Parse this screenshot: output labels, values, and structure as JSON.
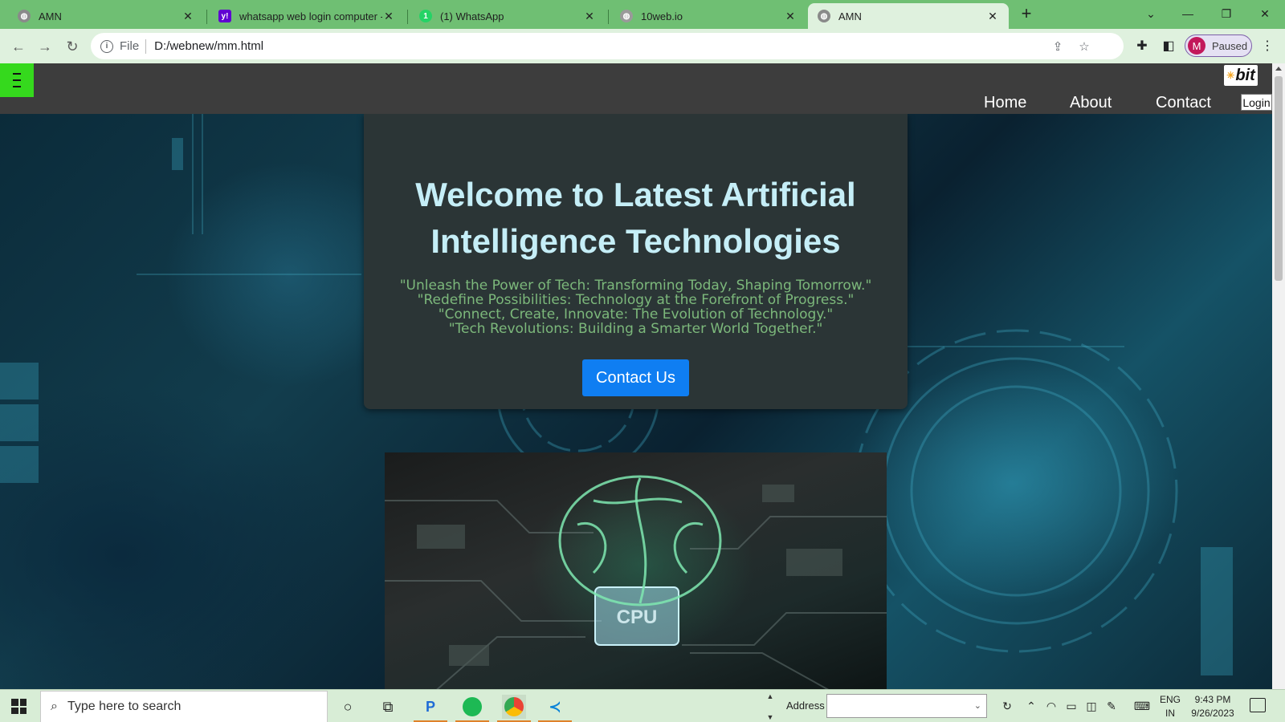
{
  "browser": {
    "tabs": [
      {
        "title": "AMN",
        "icon": "globe-icon",
        "active": false
      },
      {
        "title": "whatsapp web login computer -",
        "icon": "yahoo-icon",
        "active": false
      },
      {
        "title": "(1) WhatsApp",
        "icon": "whatsapp-icon",
        "active": false
      },
      {
        "title": "10web.io",
        "icon": "globe-icon",
        "active": false
      },
      {
        "title": "AMN",
        "icon": "globe-icon",
        "active": true
      }
    ],
    "address": {
      "scheme_label": "File",
      "url": "D:/webnew/mm.html"
    },
    "profile": {
      "initial": "M",
      "status": "Paused"
    }
  },
  "site": {
    "logo_text": "bit",
    "nav": {
      "home": "Home",
      "about": "About",
      "contact": "Contact",
      "login": "Login"
    },
    "hero": {
      "heading_line1": "Welcome to Latest Artificial",
      "heading_line2": "Intelligence Technologies",
      "quotes": [
        "\"Unleash the Power of Tech: Transforming Today, Shaping Tomorrow.\"",
        "\"Redefine Possibilities: Technology at the Forefront of Progress.\"",
        "\"Connect, Create, Innovate: The Evolution of Technology.\"",
        "\"Tech Revolutions: Building a Smarter World Together.\""
      ],
      "cta_label": "Contact Us",
      "image_chip_text": "CPU"
    }
  },
  "taskbar": {
    "search_placeholder": "Type here to search",
    "address_label": "Address",
    "language": "ENG",
    "region": "IN",
    "time": "9:43 PM",
    "date": "9/26/2023"
  },
  "colors": {
    "tabstrip": "#6fbf73",
    "toolbar": "#dff1de",
    "navbar": "#3d3d3d",
    "burger": "#35d91d",
    "heading": "#c5eef7",
    "quotes": "#7cb87b",
    "cta": "#0f7ef2"
  }
}
